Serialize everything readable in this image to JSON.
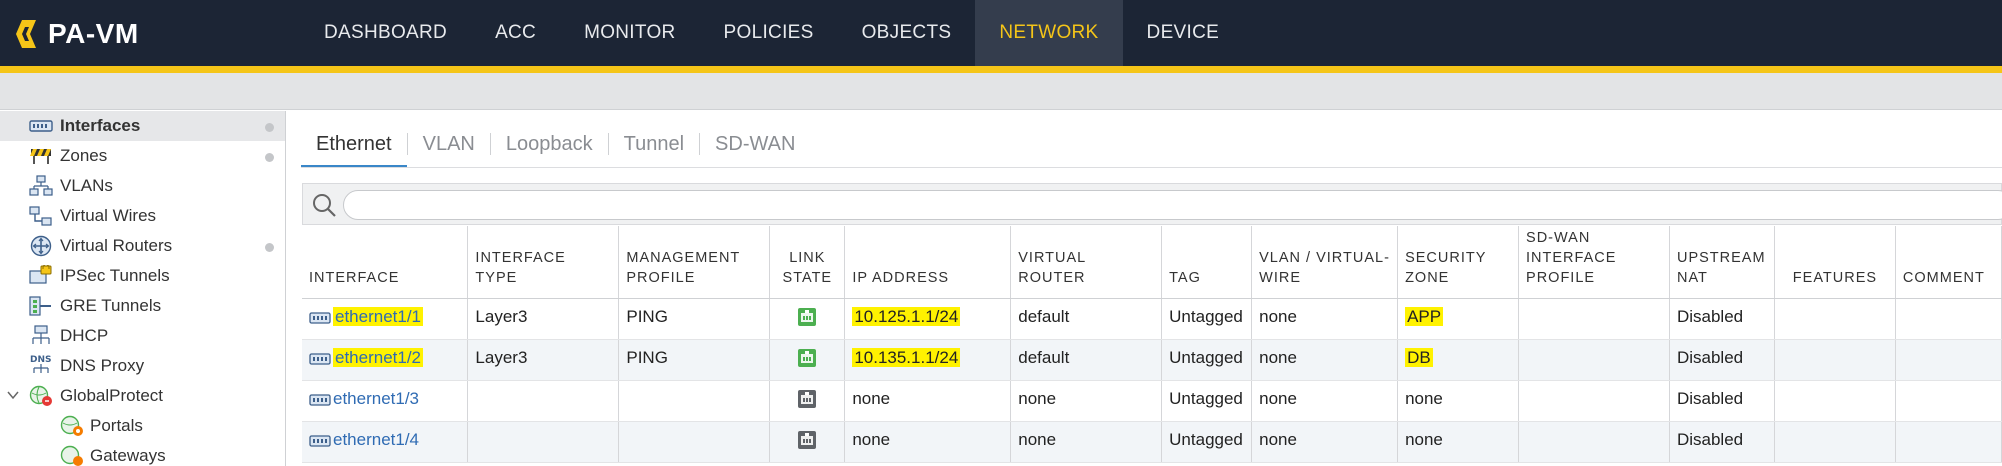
{
  "app": {
    "logo_text": "PA-VM"
  },
  "nav": {
    "items": [
      "DASHBOARD",
      "ACC",
      "MONITOR",
      "POLICIES",
      "OBJECTS",
      "NETWORK",
      "DEVICE"
    ],
    "active": "NETWORK"
  },
  "sidebar": {
    "items": [
      {
        "label": "Interfaces",
        "icon": "interfaces-icon"
      },
      {
        "label": "Zones",
        "icon": "zones-icon"
      },
      {
        "label": "VLANs",
        "icon": "vlans-icon"
      },
      {
        "label": "Virtual Wires",
        "icon": "virtual-wires-icon"
      },
      {
        "label": "Virtual Routers",
        "icon": "virtual-routers-icon"
      },
      {
        "label": "IPSec Tunnels",
        "icon": "ipsec-tunnels-icon"
      },
      {
        "label": "GRE Tunnels",
        "icon": "gre-tunnels-icon"
      },
      {
        "label": "DHCP",
        "icon": "dhcp-icon"
      },
      {
        "label": "DNS Proxy",
        "icon": "dns-proxy-icon"
      },
      {
        "label": "GlobalProtect",
        "icon": "globalprotect-icon"
      },
      {
        "label": "Portals",
        "icon": "portals-icon"
      },
      {
        "label": "Gateways",
        "icon": "gateways-icon"
      }
    ],
    "dns_icon_text": "DNS"
  },
  "tabs": [
    "Ethernet",
    "VLAN",
    "Loopback",
    "Tunnel",
    "SD-WAN"
  ],
  "search": {
    "placeholder": ""
  },
  "table": {
    "headers": {
      "interface": "INTERFACE",
      "interface_type": "INTERFACE TYPE",
      "mgmt_1": "MANAGEMENT",
      "mgmt_2": "PROFILE",
      "link_1": "LINK",
      "link_2": "STATE",
      "ip": "IP ADDRESS",
      "vr": "VIRTUAL ROUTER",
      "tag": "TAG",
      "vlan_1": "VLAN / VIRTUAL-",
      "vlan_2": "WIRE",
      "zone_1": "SECURITY",
      "zone_2": "ZONE",
      "sdwan_1": "SD-WAN",
      "sdwan_2": "INTERFACE",
      "sdwan_3": "PROFILE",
      "nat_1": "UPSTREAM",
      "nat_2": "NAT",
      "features": "FEATURES",
      "comment": "COMMENT"
    },
    "rows": [
      {
        "interface": "ethernet1/1",
        "type": "Layer3",
        "mgmt": "PING",
        "link_state": "up",
        "ip": "10.125.1.1/24",
        "vr": "default",
        "tag": "Untagged",
        "vlan": "none",
        "zone": "APP",
        "sdwan": "",
        "nat": "Disabled",
        "features": "",
        "comment": ""
      },
      {
        "interface": "ethernet1/2",
        "type": "Layer3",
        "mgmt": "PING",
        "link_state": "up",
        "ip": "10.135.1.1/24",
        "vr": "default",
        "tag": "Untagged",
        "vlan": "none",
        "zone": "DB",
        "sdwan": "",
        "nat": "Disabled",
        "features": "",
        "comment": ""
      },
      {
        "interface": "ethernet1/3",
        "type": "",
        "mgmt": "",
        "link_state": "down",
        "ip": "none",
        "vr": "none",
        "tag": "Untagged",
        "vlan": "none",
        "zone": "none",
        "sdwan": "",
        "nat": "Disabled",
        "features": "",
        "comment": ""
      },
      {
        "interface": "ethernet1/4",
        "type": "",
        "mgmt": "",
        "link_state": "down",
        "ip": "none",
        "vr": "none",
        "tag": "Untagged",
        "vlan": "none",
        "zone": "none",
        "sdwan": "",
        "nat": "Disabled",
        "features": "",
        "comment": ""
      }
    ]
  },
  "colors": {
    "topbar": "#1c2535",
    "accent": "#f5c518",
    "active_nav_text": "#f5c518",
    "link": "#2f6bb3",
    "highlight": "#fff200",
    "link_up": "#4caf50",
    "link_down": "#5f6368"
  }
}
